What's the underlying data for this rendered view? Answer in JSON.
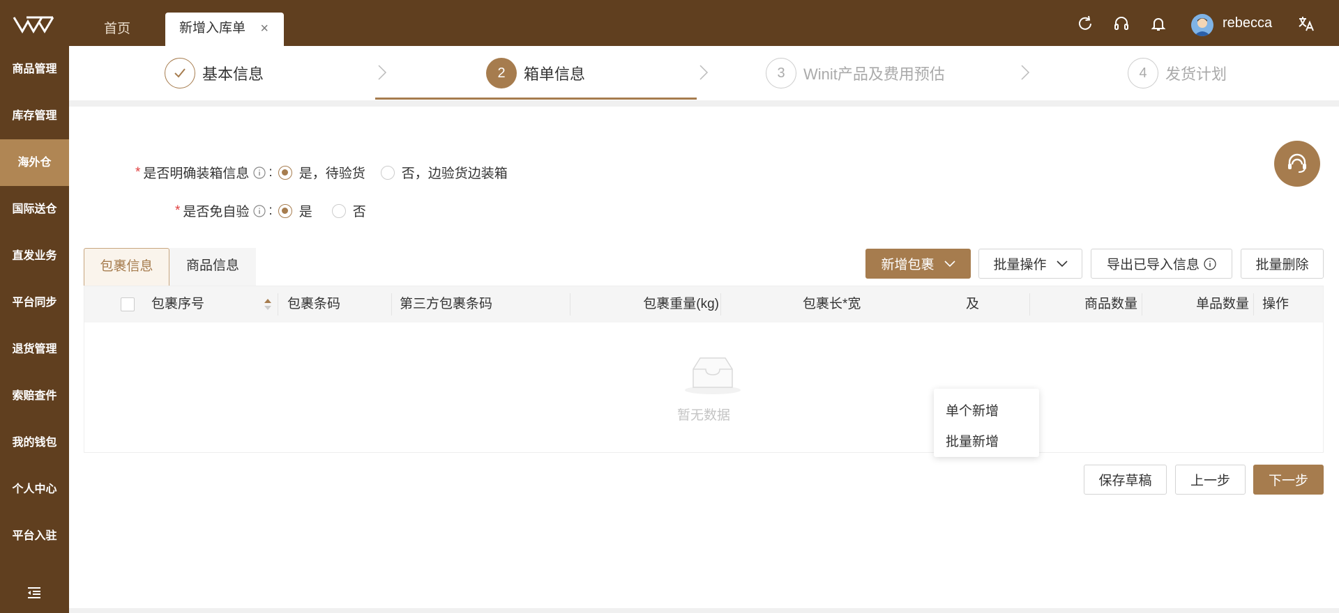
{
  "tabs": {
    "home": "首页",
    "active": "新增入库单",
    "close": "×"
  },
  "user": {
    "name": "rebecca"
  },
  "sidebar": {
    "items": [
      {
        "label": "商品管理"
      },
      {
        "label": "库存管理"
      },
      {
        "label": "海外仓"
      },
      {
        "label": "国际送仓"
      },
      {
        "label": "直发业务"
      },
      {
        "label": "平台同步"
      },
      {
        "label": "退货管理"
      },
      {
        "label": "索赔查件"
      },
      {
        "label": "我的钱包"
      },
      {
        "label": "个人中心"
      },
      {
        "label": "平台入驻"
      }
    ],
    "active_index": 2
  },
  "steps": [
    {
      "num": "",
      "label": "基本信息",
      "state": "done"
    },
    {
      "num": "2",
      "label": "箱单信息",
      "state": "current"
    },
    {
      "num": "3",
      "label": "Winit产品及费用预估",
      "state": "todo"
    },
    {
      "num": "4",
      "label": "发货计划",
      "state": "todo"
    }
  ],
  "form": {
    "q1": {
      "label": "是否明确装箱信息",
      "colon": ":",
      "opt_yes": "是，待验货",
      "opt_no": "否，边验货边装箱",
      "selected": "yes"
    },
    "q2": {
      "label": "是否免自验",
      "colon": ":",
      "opt_yes": "是",
      "opt_no": "否",
      "selected": "yes"
    }
  },
  "subtabs": {
    "parcel": "包裹信息",
    "goods": "商品信息"
  },
  "actions": {
    "add_parcel": "新增包裹",
    "batch_ops": "批量操作",
    "export": "导出已导入信息",
    "batch_delete": "批量删除"
  },
  "dropdown": {
    "single": "单个新增",
    "batch": "批量新增"
  },
  "table": {
    "headers": {
      "seq": "包裹序号",
      "barcode": "包裹条码",
      "third": "第三方包裹条码",
      "weight": "包裹重量(kg)",
      "dims": "包裹长*宽",
      "dims_tail": "及",
      "goods_qty": "商品数量",
      "unit_qty": "单品数量",
      "ops": "操作"
    },
    "empty": "暂无数据"
  },
  "footer": {
    "draft": "保存草稿",
    "prev": "上一步",
    "next": "下一步"
  },
  "colors": {
    "brand_dark": "#603f1f",
    "accent": "#a67c4e",
    "required": "#e04040"
  }
}
